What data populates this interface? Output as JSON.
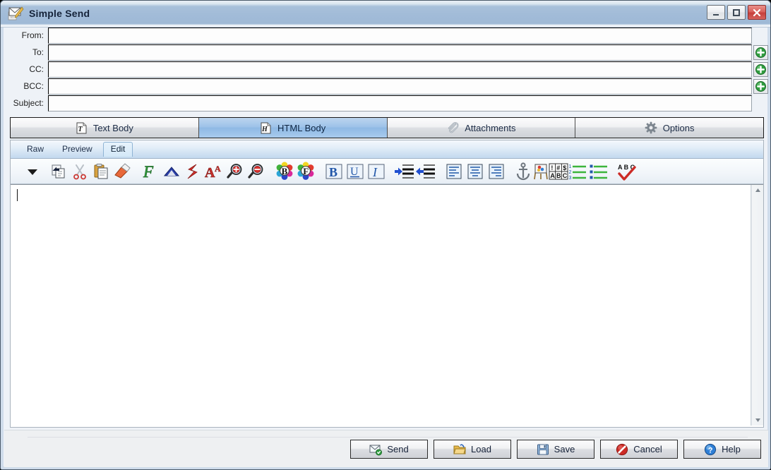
{
  "window": {
    "title": "Simple Send",
    "icon": "mail-compose-icon",
    "controls": [
      {
        "name": "minimize",
        "label": "Minimize",
        "glyph": "minimize-icon"
      },
      {
        "name": "maximize",
        "label": "Maximize",
        "glyph": "maximize-icon"
      },
      {
        "name": "close",
        "label": "Close",
        "glyph": "close-icon"
      }
    ]
  },
  "fields": [
    {
      "label": "From:",
      "value": "",
      "placeholder": "",
      "has_address_button": false,
      "name": "from"
    },
    {
      "label": "To:",
      "value": "",
      "placeholder": "",
      "has_address_button": true,
      "name": "to"
    },
    {
      "label": "CC:",
      "value": "",
      "placeholder": "",
      "has_address_button": true,
      "name": "cc"
    },
    {
      "label": "BCC:",
      "value": "",
      "placeholder": "",
      "has_address_button": true,
      "name": "bcc"
    },
    {
      "label": "Subject:",
      "value": "",
      "placeholder": "",
      "has_address_button": false,
      "name": "subject"
    }
  ],
  "tabs": [
    {
      "label": "Text Body",
      "icon": "text-page-icon",
      "active": false
    },
    {
      "label": "HTML Body",
      "icon": "html-page-icon",
      "active": true
    },
    {
      "label": "Attachments",
      "icon": "paperclip-icon",
      "active": false
    },
    {
      "label": "Options",
      "icon": "gear-icon",
      "active": false
    }
  ],
  "subtabs": [
    {
      "label": "Raw",
      "active": false
    },
    {
      "label": "Preview",
      "active": false
    },
    {
      "label": "Edit",
      "active": true
    }
  ],
  "toolbar": {
    "items": [
      {
        "name": "toolbar-overflow-arrow",
        "icon": "chevron-down-icon",
        "tooltip": "More"
      },
      {
        "name": "copy",
        "icon": "copy-icon",
        "tooltip": "Copy"
      },
      {
        "name": "cut",
        "icon": "scissors-icon",
        "tooltip": "Cut"
      },
      {
        "name": "paste",
        "icon": "clipboard-icon",
        "tooltip": "Paste"
      },
      {
        "name": "erase",
        "icon": "eraser-icon",
        "tooltip": "Erase"
      },
      {
        "name": "font",
        "icon": "font-f-icon",
        "tooltip": "Font"
      },
      {
        "name": "superscript",
        "icon": "caret-up-icon",
        "tooltip": "Superscript"
      },
      {
        "name": "subscript",
        "icon": "lightning-s-icon",
        "tooltip": "Subscript"
      },
      {
        "name": "font-size",
        "icon": "font-size-aa-icon",
        "tooltip": "Font Size"
      },
      {
        "name": "zoom-in",
        "icon": "magnifier-plus-icon",
        "tooltip": "Increase Size"
      },
      {
        "name": "zoom-out",
        "icon": "magnifier-minus-icon",
        "tooltip": "Decrease Size"
      },
      {
        "name": "background-color",
        "icon": "color-wheel-b-icon",
        "tooltip": "Background Color"
      },
      {
        "name": "foreground-color",
        "icon": "color-wheel-f-icon",
        "tooltip": "Foreground Color"
      },
      {
        "name": "bold",
        "icon": "bold-icon",
        "tooltip": "Bold"
      },
      {
        "name": "underline",
        "icon": "underline-icon",
        "tooltip": "Underline"
      },
      {
        "name": "italic",
        "icon": "italic-icon",
        "tooltip": "Italic"
      },
      {
        "name": "indent",
        "icon": "indent-icon",
        "tooltip": "Indent"
      },
      {
        "name": "outdent",
        "icon": "outdent-icon",
        "tooltip": "Outdent"
      },
      {
        "name": "align-left",
        "icon": "align-left-icon",
        "tooltip": "Align Left"
      },
      {
        "name": "align-center",
        "icon": "align-center-icon",
        "tooltip": "Align Center"
      },
      {
        "name": "align-right",
        "icon": "align-right-icon",
        "tooltip": "Align Right"
      },
      {
        "name": "insert-anchor",
        "icon": "anchor-icon",
        "tooltip": "Insert Link"
      },
      {
        "name": "insert-image",
        "icon": "easel-image-icon",
        "tooltip": "Insert Image"
      },
      {
        "name": "special-character",
        "icon": "special-char-icon",
        "tooltip": "Special Character"
      },
      {
        "name": "numbered-list",
        "icon": "numbered-list-icon",
        "tooltip": "Numbered List"
      },
      {
        "name": "bulleted-list",
        "icon": "bulleted-list-icon",
        "tooltip": "Bulleted List"
      },
      {
        "name": "spell-check",
        "icon": "spell-check-icon",
        "tooltip": "Spell Check"
      }
    ]
  },
  "editor": {
    "content": "",
    "placeholder": "",
    "scrollbar": {
      "up": "scroll-up-arrow-icon",
      "down": "scroll-down-arrow-icon"
    }
  },
  "footer": {
    "buttons": [
      {
        "label": "Send",
        "icon": "send-mail-icon",
        "name": "send"
      },
      {
        "label": "Load",
        "icon": "open-folder-icon",
        "name": "load"
      },
      {
        "label": "Save",
        "icon": "floppy-disk-icon",
        "name": "save"
      },
      {
        "label": "Cancel",
        "icon": "cancel-icon",
        "name": "cancel"
      },
      {
        "label": "Help",
        "icon": "help-icon",
        "name": "help"
      }
    ]
  },
  "colors": {
    "titlebar": "#a1bbd8",
    "active_tab": "#9ec3e9",
    "close_button": "#c6403c",
    "accent": "#2f6fb5"
  }
}
